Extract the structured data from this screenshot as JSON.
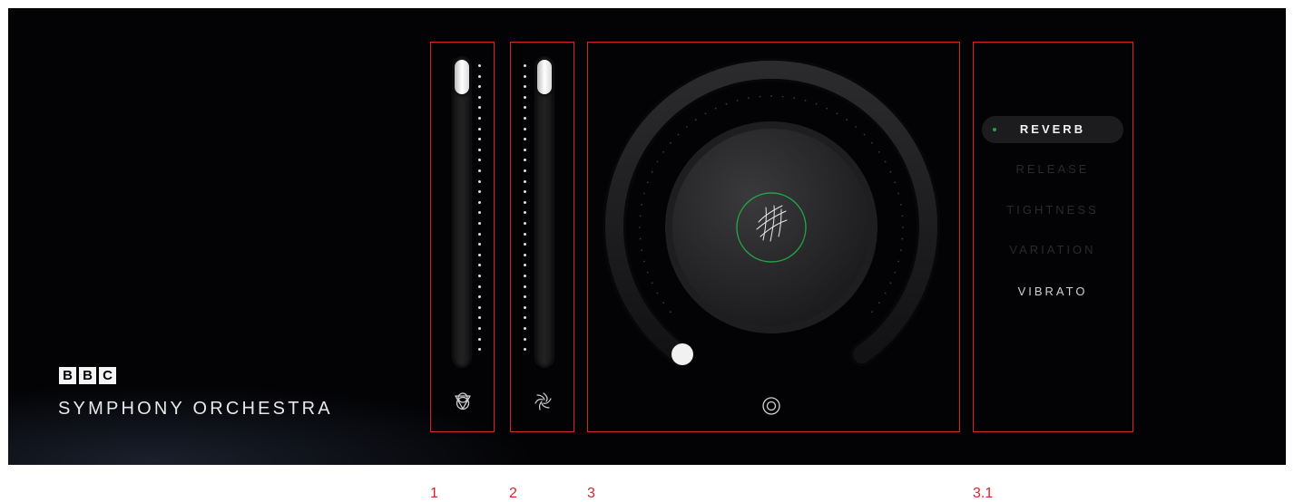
{
  "brand": {
    "logo_letters": [
      "B",
      "B",
      "C"
    ],
    "product_title": "SYMPHONY ORCHESTRA"
  },
  "sliders": [
    {
      "id": "slider-1",
      "icon": "triangle-circles-icon",
      "value": 1.0
    },
    {
      "id": "slider-2",
      "icon": "shutter-icon",
      "value": 1.0
    }
  ],
  "dial": {
    "center_icon": "crosshatch-texture-icon",
    "footer_icon": "concentric-circle-icon",
    "value": 0.0
  },
  "modes": {
    "items": [
      {
        "label": "REVERB",
        "state": "active"
      },
      {
        "label": "RELEASE",
        "state": "dim"
      },
      {
        "label": "TIGHTNESS",
        "state": "dim"
      },
      {
        "label": "VARIATION",
        "state": "dim"
      },
      {
        "label": "VIBRATO",
        "state": "normal"
      }
    ]
  },
  "annotations": {
    "labels": [
      "1",
      "2",
      "3",
      "3.1"
    ],
    "color": "#d3262c"
  },
  "colors": {
    "panel_bg": "#030305",
    "accent_green": "#25a04a",
    "highlight_red": "#d3262c"
  }
}
